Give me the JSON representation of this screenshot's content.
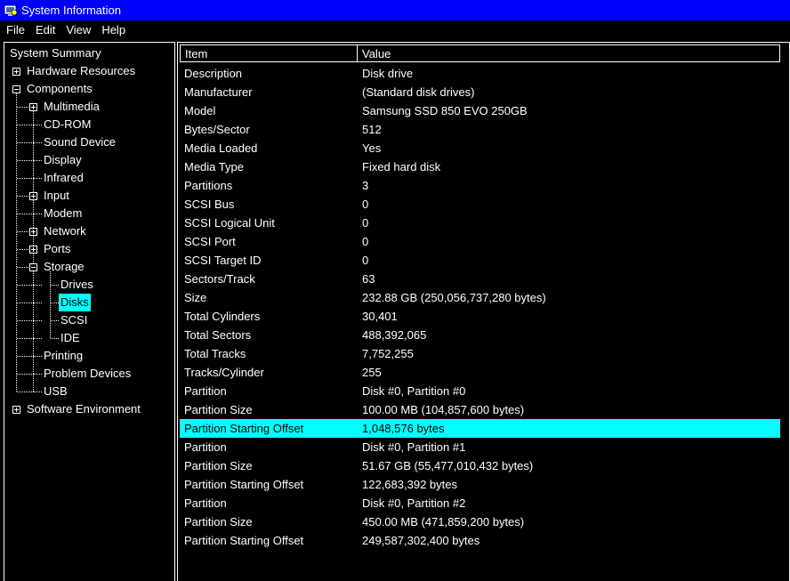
{
  "window": {
    "title": "System Information",
    "icon": "system-info-icon"
  },
  "menu": [
    "File",
    "Edit",
    "View",
    "Help"
  ],
  "tree": {
    "items": [
      {
        "label": "System Summary",
        "level": 0,
        "expander": "none"
      },
      {
        "label": "Hardware Resources",
        "level": 1,
        "expander": "plus"
      },
      {
        "label": "Components",
        "level": 1,
        "expander": "minus"
      },
      {
        "label": "Multimedia",
        "level": 2,
        "expander": "plus"
      },
      {
        "label": "CD-ROM",
        "level": 2,
        "expander": "none"
      },
      {
        "label": "Sound Device",
        "level": 2,
        "expander": "none"
      },
      {
        "label": "Display",
        "level": 2,
        "expander": "none"
      },
      {
        "label": "Infrared",
        "level": 2,
        "expander": "none"
      },
      {
        "label": "Input",
        "level": 2,
        "expander": "plus"
      },
      {
        "label": "Modem",
        "level": 2,
        "expander": "none"
      },
      {
        "label": "Network",
        "level": 2,
        "expander": "plus"
      },
      {
        "label": "Ports",
        "level": 2,
        "expander": "plus"
      },
      {
        "label": "Storage",
        "level": 2,
        "expander": "minus"
      },
      {
        "label": "Drives",
        "level": 3,
        "expander": "none"
      },
      {
        "label": "Disks",
        "level": 3,
        "expander": "none",
        "selected": true
      },
      {
        "label": "SCSI",
        "level": 3,
        "expander": "none"
      },
      {
        "label": "IDE",
        "level": 3,
        "expander": "none"
      },
      {
        "label": "Printing",
        "level": 2,
        "expander": "none"
      },
      {
        "label": "Problem Devices",
        "level": 2,
        "expander": "none"
      },
      {
        "label": "USB",
        "level": 2,
        "expander": "none"
      },
      {
        "label": "Software Environment",
        "level": 1,
        "expander": "plus"
      }
    ]
  },
  "table": {
    "headers": [
      "Item",
      "Value"
    ],
    "rows": [
      [
        "Description",
        "Disk drive"
      ],
      [
        "Manufacturer",
        "(Standard disk drives)"
      ],
      [
        "Model",
        "Samsung SSD 850 EVO 250GB"
      ],
      [
        "Bytes/Sector",
        "512"
      ],
      [
        "Media Loaded",
        "Yes"
      ],
      [
        "Media Type",
        "Fixed hard disk"
      ],
      [
        "Partitions",
        "3"
      ],
      [
        "SCSI Bus",
        "0"
      ],
      [
        "SCSI Logical Unit",
        "0"
      ],
      [
        "SCSI Port",
        "0"
      ],
      [
        "SCSI Target ID",
        "0"
      ],
      [
        "Sectors/Track",
        "63"
      ],
      [
        "Size",
        "232.88 GB (250,056,737,280 bytes)"
      ],
      [
        "Total Cylinders",
        "30,401"
      ],
      [
        "Total Sectors",
        "488,392,065"
      ],
      [
        "Total Tracks",
        "7,752,255"
      ],
      [
        "Tracks/Cylinder",
        "255"
      ],
      [
        "Partition",
        "Disk #0, Partition #0"
      ],
      [
        "Partition Size",
        "100.00 MB (104,857,600 bytes)"
      ],
      [
        "Partition Starting Offset",
        "1,048,576 bytes"
      ],
      [
        "Partition",
        "Disk #0, Partition #1"
      ],
      [
        "Partition Size",
        "51.67 GB (55,477,010,432 bytes)"
      ],
      [
        "Partition Starting Offset",
        "122,683,392 bytes"
      ],
      [
        "Partition",
        "Disk #0, Partition #2"
      ],
      [
        "Partition Size",
        "450.00 MB (471,859,200 bytes)"
      ],
      [
        "Partition Starting Offset",
        "249,587,302,400 bytes"
      ]
    ],
    "selected_row": 19
  },
  "colors": {
    "selection": "#00ffff",
    "titlebar": "#0000ff",
    "background": "#000000",
    "text": "#ffffff"
  }
}
